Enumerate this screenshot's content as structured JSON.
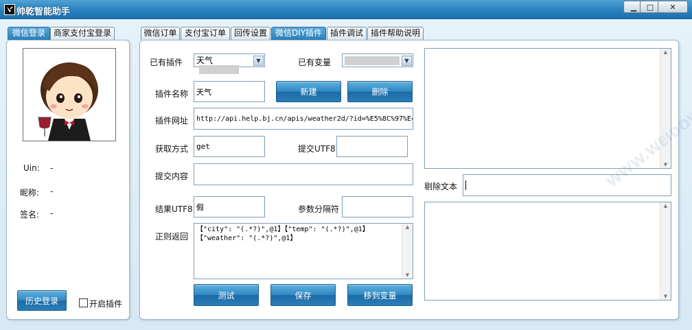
{
  "window": {
    "title": "帅乾智能助手",
    "minimize_glyph": "▁",
    "maximize_glyph": "□",
    "close_glyph": "✕"
  },
  "left_tabs": [
    {
      "label": "微信登录",
      "active": true
    },
    {
      "label": "商家支付宝登录",
      "active": false
    }
  ],
  "main_tabs": [
    {
      "label": "微信订单",
      "active": false
    },
    {
      "label": "支付宝订单",
      "active": false
    },
    {
      "label": "回传设置",
      "active": false
    },
    {
      "label": "微信DIY插件",
      "active": true
    },
    {
      "label": "插件调试",
      "active": false
    },
    {
      "label": "插件帮助说明",
      "active": false
    }
  ],
  "profile": {
    "uin_label": "Uin:",
    "uin_value": "-",
    "nickname_label": "昵称:",
    "nickname_value": "-",
    "signature_label": "签名:",
    "signature_value": "-",
    "history_login_label": "历史登录",
    "enable_plugin_label": "开启插件",
    "enable_plugin_checked": false
  },
  "form": {
    "existing_plugin_label": "已有插件",
    "existing_plugin_value": "天气",
    "existing_var_label": "已有变量",
    "existing_var_value": "",
    "plugin_name_label": "插件名称",
    "plugin_name_value": "天气",
    "new_button": "新建",
    "delete_button": "删除",
    "plugin_url_label": "插件网址",
    "plugin_url_value": "http://api.help.bj.cn/apis/weather2d/?id=%E5%8C%97%E4",
    "method_label": "获取方式",
    "method_value": "get",
    "submit_utf8_label": "提交UTF8",
    "submit_utf8_value": "",
    "submit_content_label": "提交内容",
    "submit_content_value": "",
    "result_utf8_label": "结果UTF8",
    "result_utf8_value": "假",
    "param_sep_label": "参数分隔符",
    "param_sep_value": "",
    "regex_return_label": "正则返回",
    "regex_return_line1": "【\"city\": \"(.*?)\",@1】【\"temp\": \"(.*?)\",@1】",
    "regex_return_line2": "【\"weather\": \"(.*?)\",@1】",
    "test_button": "测试",
    "save_button": "保存",
    "move_to_var_button": "移到变量"
  },
  "right": {
    "remove_text_label": "剔除文本",
    "remove_text_value": ""
  },
  "watermark": "WWW.WEIDOWN.COM",
  "colors": {
    "titlebar": "#2e86c2",
    "active_tab": "#2b7fba",
    "button": "#2f88c3"
  }
}
